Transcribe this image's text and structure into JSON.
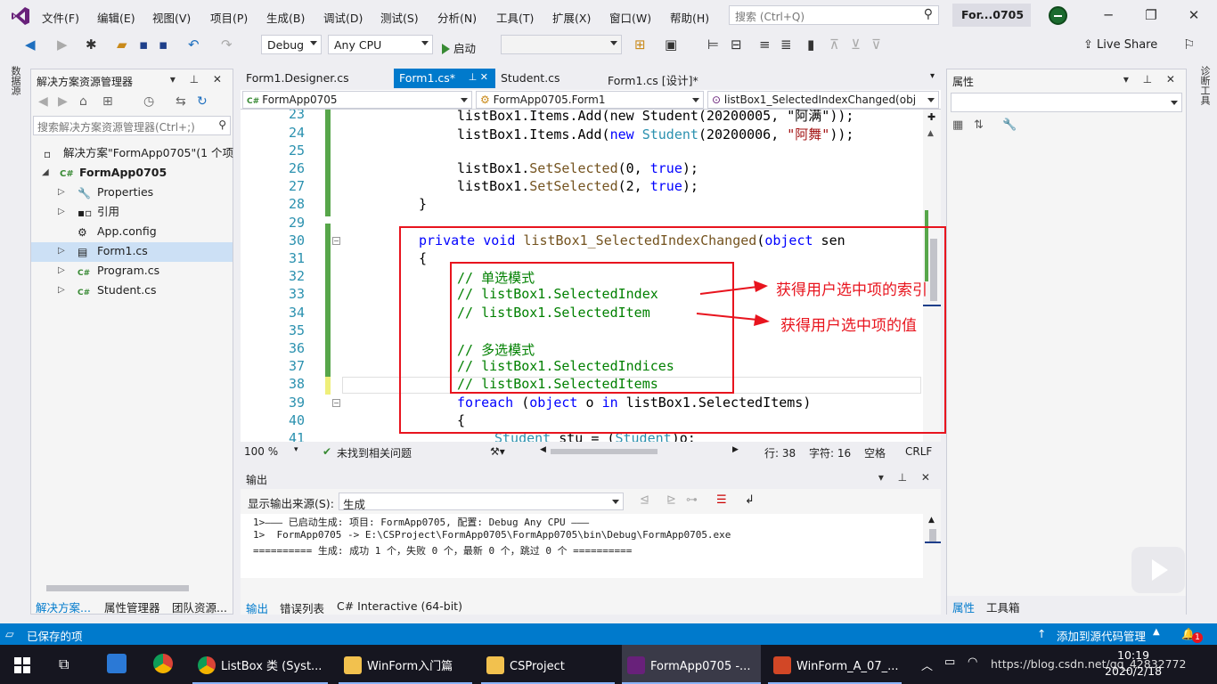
{
  "menubar": {
    "items": [
      "文件(F)",
      "编辑(E)",
      "视图(V)",
      "项目(P)",
      "生成(B)",
      "调试(D)",
      "测试(S)",
      "分析(N)",
      "工具(T)",
      "扩展(X)",
      "窗口(W)",
      "帮助(H)"
    ],
    "search_placeholder": "搜索 (Ctrl+Q)",
    "window_title": "For...0705"
  },
  "toolbar": {
    "config": "Debug",
    "platform": "Any CPU",
    "start_label": "启动",
    "live_share": "Live Share"
  },
  "left_strip_label": "数据源",
  "right_strip_label": "诊断工具",
  "solution_explorer": {
    "title": "解决方案资源管理器",
    "search_placeholder": "搜索解决方案资源管理器(Ctrl+;)",
    "solution_label": "解决方案\"FormApp0705\"(1 个项",
    "project_label": "FormApp0705",
    "items": [
      "Properties",
      "引用",
      "App.config",
      "Form1.cs",
      "Program.cs",
      "Student.cs"
    ],
    "bottom_tabs": [
      "解决方案...",
      "属性管理器",
      "团队资源..."
    ]
  },
  "editor": {
    "tabs": [
      "Form1.Designer.cs",
      "Form1.cs*",
      "Student.cs",
      "Form1.cs [设计]*"
    ],
    "nav": [
      "FormApp0705",
      "FormApp0705.Form1",
      "listBox1_SelectedIndexChanged(obj"
    ],
    "line_numbers": [
      "23",
      "24",
      "25",
      "26",
      "27",
      "28",
      "29",
      "30",
      "31",
      "32",
      "33",
      "34",
      "35",
      "36",
      "37",
      "38",
      "39",
      "40",
      "41"
    ],
    "code": {
      "l23": "listBox1.Items.Add(new Student(20200005, \"阿满\"));",
      "l24_a": "listBox1.Items.Add(",
      "l24_kw": "new",
      "l24_ty": "Student",
      "l24_b": "(20200006, ",
      "l24_st": "\"阿舞\"",
      "l24_c": "));",
      "l26_a": "listBox1.",
      "l26_m": "SetSelected",
      "l26_b": "(0, ",
      "l26_kw": "true",
      "l26_c": ");",
      "l27_a": "listBox1.",
      "l27_m": "SetSelected",
      "l27_b": "(2, ",
      "l27_kw": "true",
      "l27_c": ");",
      "l28": "}",
      "l30_kw1": "private",
      "l30_kw2": "void",
      "l30_m": "listBox1_SelectedIndexChanged",
      "l30_b": "(",
      "l30_kw3": "object",
      "l30_c": " sen",
      "l31": "{",
      "l32": "// 单选模式",
      "l33": "// listBox1.SelectedIndex",
      "l34": "// listBox1.SelectedItem",
      "l36": "// 多选模式",
      "l37": "// listBox1.SelectedIndices",
      "l38": "// listBox1.SelectedItems",
      "l39_kw1": "foreach",
      "l39_a": " (",
      "l39_kw2": "object",
      "l39_b": " o ",
      "l39_kw3": "in",
      "l39_c": " listBox1.SelectedItems)",
      "l40": "{",
      "l41_ty1": "Student",
      "l41_a": " stu = (",
      "l41_ty2": "Student",
      "l41_b": ")o;"
    },
    "status": {
      "zoom": "100 %",
      "issues": "未找到相关问题",
      "line": "行: 38",
      "col": "字符: 16",
      "ws": "空格",
      "eol": "CRLF"
    }
  },
  "annotations": {
    "index_note": "获得用户选中项的索引",
    "value_note": "获得用户选中项的值"
  },
  "properties": {
    "title": "属性",
    "bottom_tabs": [
      "属性",
      "工具箱"
    ]
  },
  "output": {
    "title": "输出",
    "source_label": "显示输出来源(S):",
    "source_value": "生成",
    "lines": [
      "1>——— 已启动生成: 项目: FormApp0705, 配置: Debug Any CPU ———",
      "1>  FormApp0705 -> E:\\CSProject\\FormApp0705\\FormApp0705\\bin\\Debug\\FormApp0705.exe",
      "========== 生成: 成功 1 个，失败 0 个，最新 0 个，跳过 0 个 =========="
    ],
    "tabs": [
      "输出",
      "错误列表",
      "C# Interactive (64-bit)"
    ]
  },
  "statusbar": {
    "left": "已保存的项",
    "right": "添加到源代码管理",
    "badge": "1"
  },
  "taskbar": {
    "apps": [
      "ListBox 类 (Syst...",
      "WinForm入门篇",
      "CSProject",
      "FormApp0705 -...",
      "WinForm_A_07_..."
    ],
    "time": "10:19",
    "date": "2020/2/18",
    "watermark": "https://blog.csdn.net/qq_42832772"
  },
  "colors": {
    "accent": "#007acc",
    "annotation_red": "#e8141e",
    "keyword": "#0000ff",
    "type": "#2b91af",
    "comment": "#008000",
    "string": "#a31515"
  }
}
